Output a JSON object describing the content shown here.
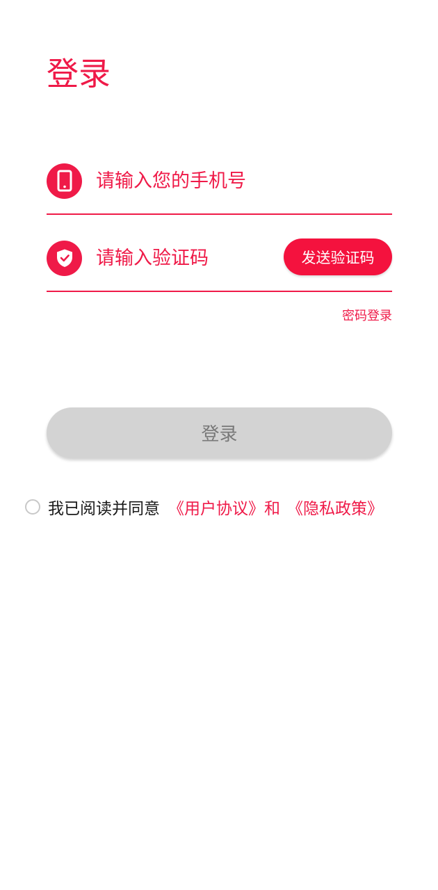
{
  "header": {
    "title": "登录"
  },
  "form": {
    "phone": {
      "placeholder": "请输入您的手机号",
      "value": "",
      "icon": "phone-icon"
    },
    "code": {
      "placeholder": "请输入验证码",
      "value": "",
      "icon": "shield-check-icon"
    },
    "send_code_label": "发送验证码",
    "password_login_label": "密码登录",
    "login_label": "登录"
  },
  "agreement": {
    "checked": false,
    "prefix": "我已阅读并同意",
    "user_agreement": "《用户协议》",
    "conjunction": "和",
    "privacy_policy": "《隐私政策》"
  },
  "colors": {
    "accent": "#ef1a48",
    "button_disabled": "#d3d3d3",
    "button_disabled_text": "#787878"
  }
}
